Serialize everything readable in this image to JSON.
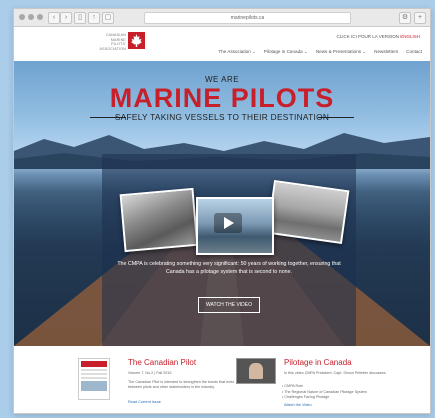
{
  "browser": {
    "url": "marinepilots.ca",
    "back": "‹",
    "forward": "›"
  },
  "header": {
    "logo_lines": [
      "Canadian",
      "Marine",
      "Pilots'",
      "Association"
    ],
    "lang_prefix": "CLICK ICI POUR LA VERSION ",
    "lang_active": "ENGLISH",
    "nav": [
      "The Association ⌄",
      "Pilotage in Canada ⌄",
      "News & Presentations ⌄",
      "Newsletters",
      "Contact"
    ]
  },
  "hero": {
    "we_are": "WE ARE",
    "title": "MARINE PILOTS",
    "subtitle": "SAFELY TAKING VESSELS TO THEIR DESTINATION",
    "caption": "The CMPA is celebrating something very significant: 50 years of working together, ensuring that Canada has a pilotage system that is second to none.",
    "watch_button": "WATCH THE VIDEO"
  },
  "content": {
    "left": {
      "heading": "The Canadian Pilot",
      "issue": "Volume 7, No.2 | Fall 2015",
      "body": "The Canadian Pilot is intended to strengthen the bonds that exist between pilots and other stakeholders in the industry.",
      "link": "Read Current Issue"
    },
    "right": {
      "heading": "Pilotage in Canada",
      "intro": "In this video CMPA President, Capt. Simon Pelletier discusses:",
      "bullets": [
        "CMPA Role",
        "The Regional Nature of Canadian Pilotage System",
        "Challenges Facing Pilotage"
      ],
      "link": "Watch the Video"
    }
  },
  "colors": {
    "brand_red": "#c8202a",
    "page_bg": "#aacdea"
  }
}
